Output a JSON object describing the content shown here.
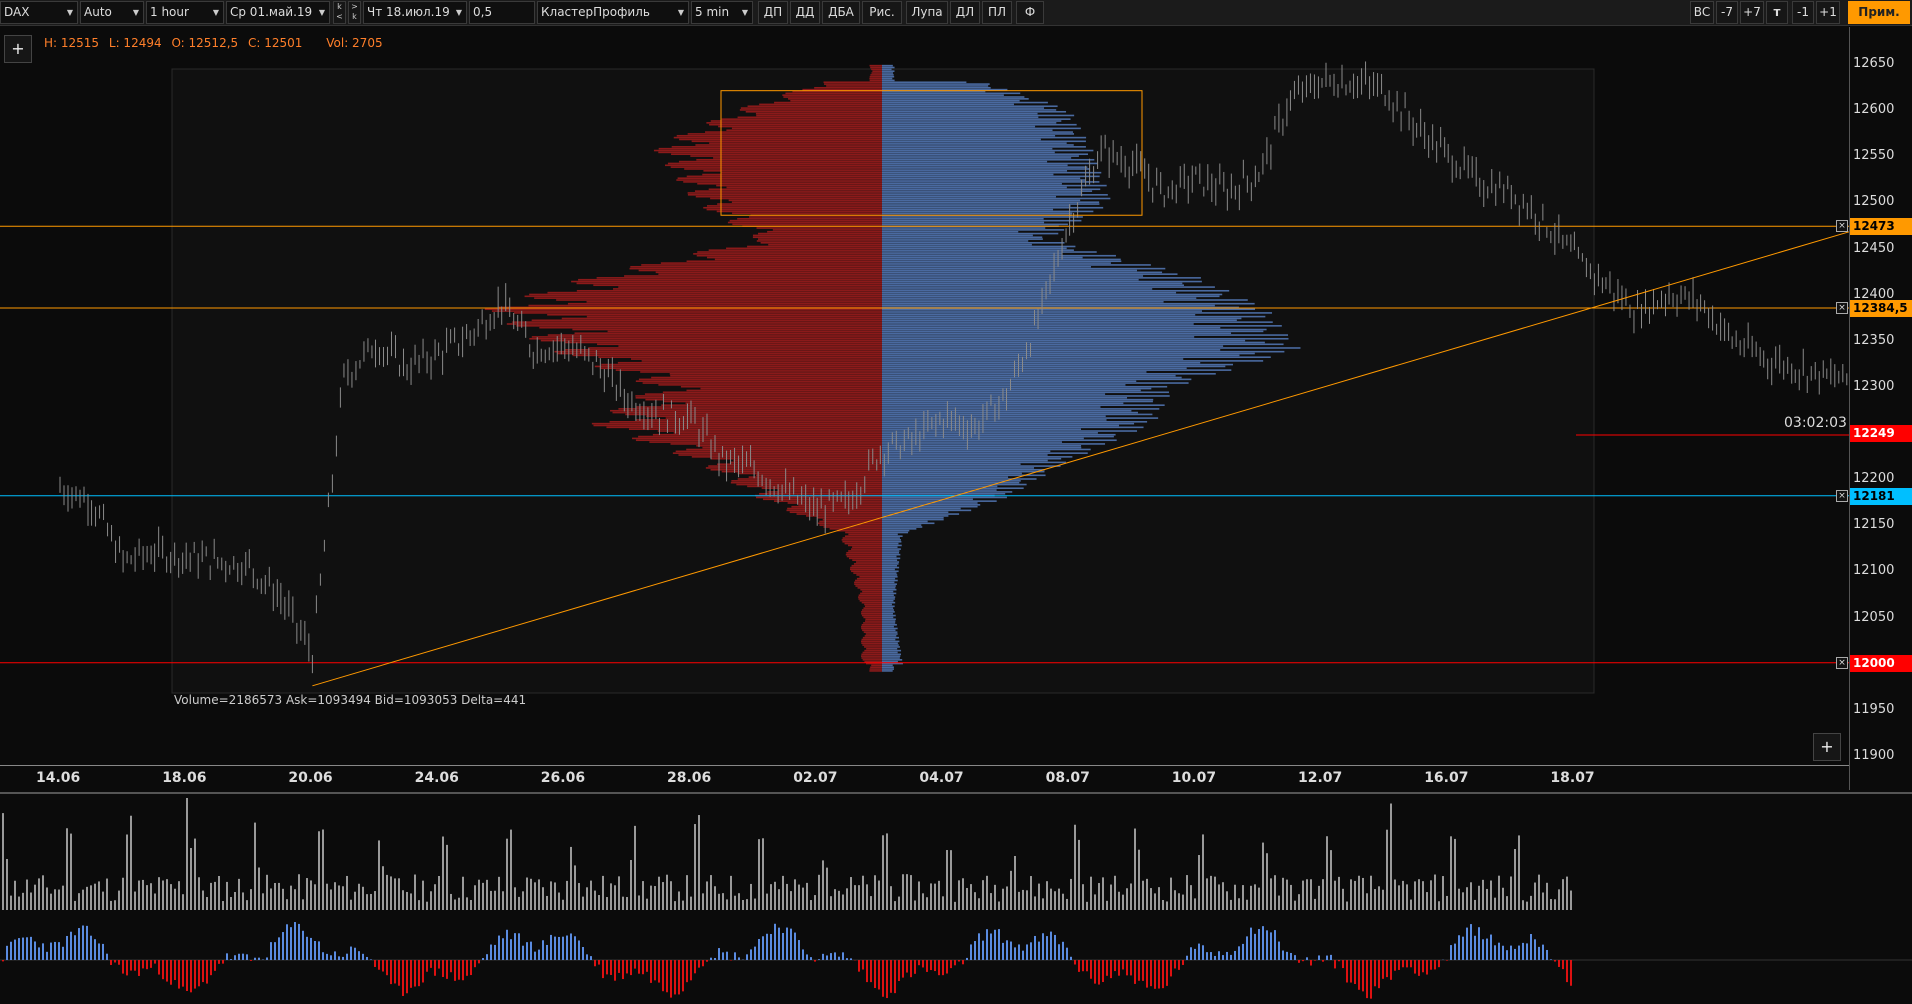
{
  "toolbar": {
    "symbol": "DAX",
    "scale": "Auto",
    "timeframe": "1 hour",
    "date_from": "Ср 01.май.19",
    "date_to": "Чт 18.июл.19",
    "step": "0,5",
    "profile_type": "КластерПрофиль",
    "profile_period": "5 min",
    "buttons": [
      "ДП",
      "ДД",
      "ДБА",
      "Рис.",
      "Лупа",
      "ДЛ",
      "ПЛ",
      "Ф"
    ],
    "right_buttons": [
      "BC",
      "-7",
      "+7",
      "т",
      "-1",
      "+1"
    ],
    "apply": "Прим."
  },
  "ohlc": {
    "high": "H: 12515",
    "low": "L: 12494",
    "open": "O: 12512,5",
    "close": "C: 12501",
    "vol": "Vol: 2705"
  },
  "profile_summary": "Volume=2186573  Ask=1093494  Bid=1093053  Delta=441",
  "timer": "03:02:03",
  "plus": "+",
  "y_ticks": [
    "12650",
    "12600",
    "12550",
    "12500",
    "12450",
    "12400",
    "12350",
    "12300",
    "12250",
    "12200",
    "12150",
    "12100",
    "12050",
    "12000",
    "11950",
    "11900"
  ],
  "levels": [
    {
      "label": "12473",
      "value": 12473,
      "color": "#ff9900"
    },
    {
      "label": "12384,5",
      "value": 12384.5,
      "color": "#ff9900"
    },
    {
      "label": "12249",
      "value": 12249,
      "color": "#ff0000"
    },
    {
      "label": "12181",
      "value": 12181,
      "color": "#00bfff"
    },
    {
      "label": "12000",
      "value": 12000,
      "color": "#ff0000"
    }
  ],
  "x_labels": [
    "14.06",
    "18.06",
    "20.06",
    "24.06",
    "26.06",
    "28.06",
    "02.07",
    "04.07",
    "08.07",
    "10.07",
    "12.07",
    "16.07",
    "18.07"
  ],
  "colors": {
    "ask": "#4a6aa0",
    "bid": "#8b1a1a",
    "level_orange": "#ff9900",
    "delta_up": "#5a8be0",
    "delta_down": "#dd1111"
  },
  "chart_data": {
    "type": "candlestick",
    "symbol": "DAX",
    "timeframe": "1 hour",
    "ylim": [
      11890,
      12665
    ],
    "y_ticks": [
      12650,
      12600,
      12550,
      12500,
      12450,
      12400,
      12350,
      12300,
      12250,
      12200,
      12150,
      12100,
      12050,
      12000,
      11950,
      11900
    ],
    "categories": [
      "14.06",
      "18.06",
      "20.06",
      "24.06",
      "26.06",
      "28.06",
      "02.07",
      "04.07",
      "08.07",
      "10.07",
      "12.07",
      "16.07",
      "18.07"
    ],
    "price_path": [
      [
        13.0,
        12190
      ],
      [
        13.5,
        12175
      ],
      [
        14.0,
        12110
      ],
      [
        14.5,
        12120
      ],
      [
        15.0,
        12115
      ],
      [
        15.5,
        12110
      ],
      [
        16.0,
        12105
      ],
      [
        16.5,
        12070
      ],
      [
        17.0,
        12010
      ],
      [
        17.5,
        12310
      ],
      [
        18.0,
        12345
      ],
      [
        18.5,
        12320
      ],
      [
        19.0,
        12335
      ],
      [
        19.5,
        12355
      ],
      [
        20.0,
        12390
      ],
      [
        20.5,
        12340
      ],
      [
        21.0,
        12345
      ],
      [
        21.5,
        12325
      ],
      [
        22.0,
        12285
      ],
      [
        22.5,
        12270
      ],
      [
        23.0,
        12265
      ],
      [
        23.5,
        12220
      ],
      [
        24.0,
        12210
      ],
      [
        24.5,
        12185
      ],
      [
        25.0,
        12165
      ],
      [
        25.5,
        12175
      ],
      [
        26.0,
        12230
      ],
      [
        26.5,
        12240
      ],
      [
        27.0,
        12265
      ],
      [
        27.5,
        12255
      ],
      [
        28.0,
        12290
      ],
      [
        28.5,
        12370
      ],
      [
        29.0,
        12480
      ],
      [
        29.5,
        12555
      ],
      [
        30.0,
        12540
      ],
      [
        30.5,
        12510
      ],
      [
        31.0,
        12525
      ],
      [
        31.5,
        12510
      ],
      [
        32.0,
        12530
      ],
      [
        32.5,
        12610
      ],
      [
        33.0,
        12630
      ],
      [
        33.5,
        12630
      ],
      [
        34.0,
        12620
      ],
      [
        34.5,
        12580
      ],
      [
        35.0,
        12550
      ],
      [
        35.5,
        12520
      ],
      [
        36.0,
        12510
      ],
      [
        36.5,
        12480
      ],
      [
        37.0,
        12440
      ],
      [
        37.5,
        12410
      ],
      [
        38.0,
        12380
      ],
      [
        38.5,
        12400
      ],
      [
        39.0,
        12390
      ],
      [
        39.5,
        12350
      ],
      [
        40.0,
        12330
      ],
      [
        40.5,
        12320
      ],
      [
        41.0,
        12310
      ],
      [
        41.5,
        12305
      ],
      [
        42.0,
        12345
      ],
      [
        42.5,
        12375
      ],
      [
        43.0,
        12395
      ],
      [
        43.5,
        12410
      ],
      [
        44.0,
        12395
      ],
      [
        44.5,
        12400
      ],
      [
        45.0,
        12320
      ],
      [
        45.5,
        12295
      ],
      [
        46.0,
        12250
      ],
      [
        46.5,
        12230
      ],
      [
        47.0,
        12210
      ],
      [
        47.5,
        12249
      ]
    ],
    "volume_profile": {
      "range": [
        11990,
        12650
      ],
      "poc_price": 12384.5,
      "levels": [
        {
          "price": 12630,
          "bid": 0.15,
          "ask": 0.25
        },
        {
          "price": 12600,
          "bid": 0.35,
          "ask": 0.45
        },
        {
          "price": 12560,
          "bid": 0.55,
          "ask": 0.5
        },
        {
          "price": 12500,
          "bid": 0.45,
          "ask": 0.55
        },
        {
          "price": 12460,
          "bid": 0.3,
          "ask": 0.4
        },
        {
          "price": 12420,
          "bid": 0.7,
          "ask": 0.75
        },
        {
          "price": 12385,
          "bid": 0.95,
          "ask": 0.92
        },
        {
          "price": 12340,
          "bid": 0.8,
          "ask": 1.0
        },
        {
          "price": 12300,
          "bid": 0.55,
          "ask": 0.7
        },
        {
          "price": 12260,
          "bid": 0.7,
          "ask": 0.65
        },
        {
          "price": 12220,
          "bid": 0.45,
          "ask": 0.45
        },
        {
          "price": 12180,
          "bid": 0.3,
          "ask": 0.3
        },
        {
          "price": 12140,
          "bid": 0.1,
          "ask": 0.05
        },
        {
          "price": 12060,
          "bid": 0.05,
          "ask": 0.03
        },
        {
          "price": 12000,
          "bid": 0.05,
          "ask": 0.05
        }
      ]
    },
    "value_area_box": {
      "price_top": 12620,
      "price_bottom": 12485
    },
    "trendline": [
      [
        17.0,
        11975
      ],
      [
        41.5,
        12470
      ]
    ],
    "profile_volume": 2186573,
    "profile_ask": 1093494,
    "profile_bid": 1093053,
    "profile_delta": 441
  }
}
